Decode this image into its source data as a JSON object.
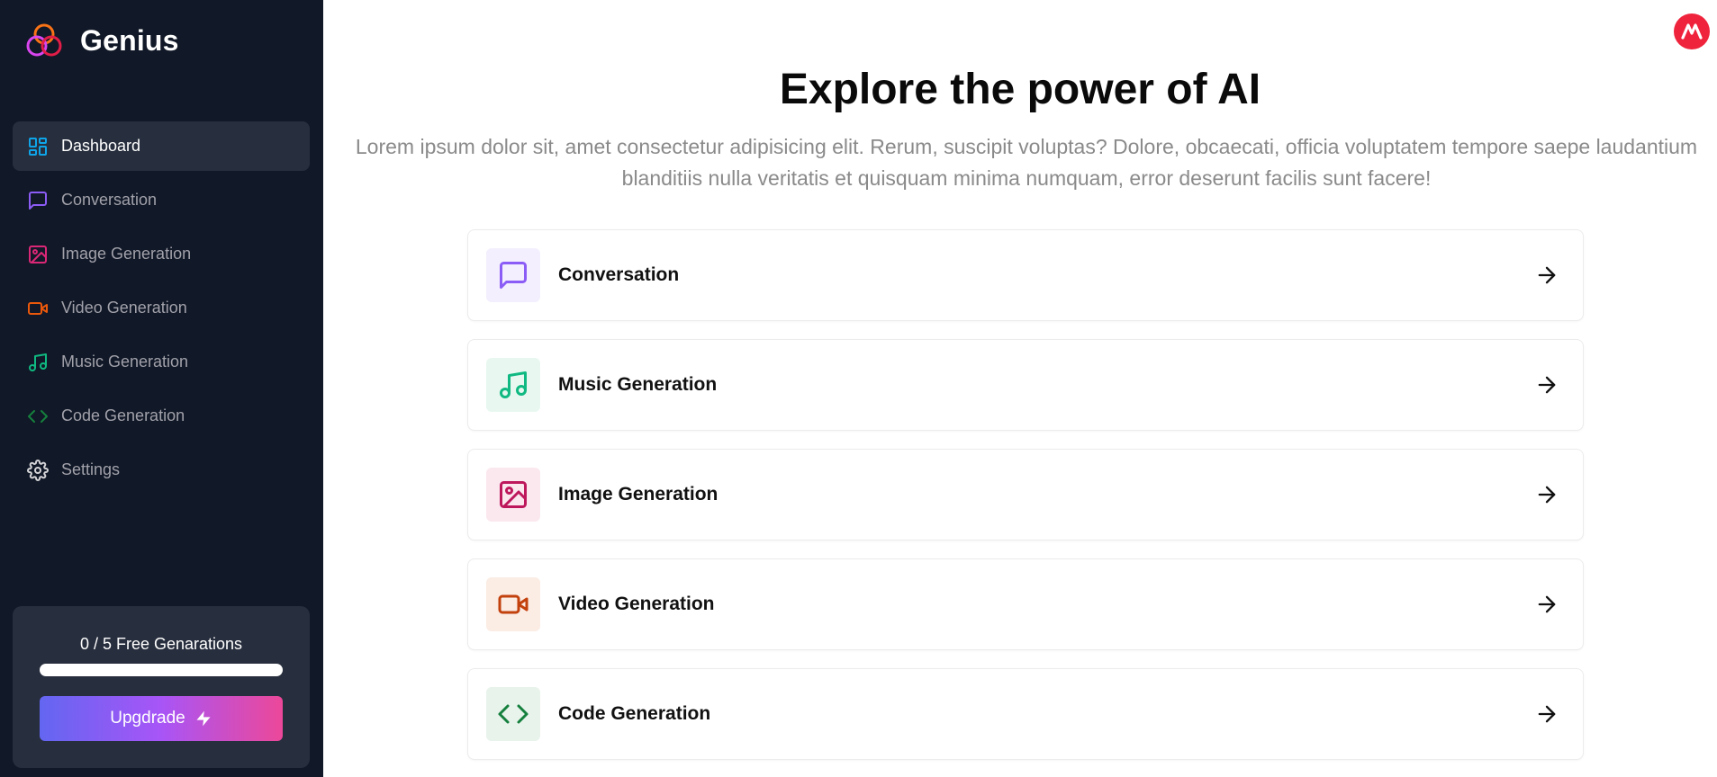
{
  "brand": {
    "name": "Genius"
  },
  "sidebar": {
    "items": [
      {
        "label": "Dashboard",
        "icon": "dashboard-icon",
        "color": "#0ea5e9",
        "active": true
      },
      {
        "label": "Conversation",
        "icon": "message-square-icon",
        "color": "#8b5cf6"
      },
      {
        "label": "Image Generation",
        "icon": "image-icon",
        "color": "#db2777"
      },
      {
        "label": "Video Generation",
        "icon": "video-icon",
        "color": "#ea580c"
      },
      {
        "label": "Music Generation",
        "icon": "music-icon",
        "color": "#10b981"
      },
      {
        "label": "Code Generation",
        "icon": "code-icon",
        "color": "#15803d"
      },
      {
        "label": "Settings",
        "icon": "settings-icon",
        "color": "#d4d4d8"
      }
    ],
    "credits": {
      "text": "0 / 5 Free Genarations",
      "used": 0,
      "limit": 5,
      "upgrade_label": "Upgdrade"
    }
  },
  "header": {
    "avatar_initial": "M",
    "avatar_color": "#ef233c"
  },
  "main": {
    "title": "Explore the power of AI",
    "description": "Lorem ipsum dolor sit, amet consectetur adipisicing elit. Rerum, suscipit voluptas? Dolore, obcaecati, officia voluptatem tempore saepe laudantium blanditiis nulla veritatis et quisquam minima numquam, error deserunt facilis sunt facere!",
    "tools": [
      {
        "label": "Conversation",
        "icon": "message-square-icon",
        "color": "#8b5cf6",
        "bg": "#f3effe"
      },
      {
        "label": "Music Generation",
        "icon": "music-icon",
        "color": "#10b981",
        "bg": "#e8f8f1"
      },
      {
        "label": "Image Generation",
        "icon": "image-icon",
        "color": "#be185d",
        "bg": "#fbe8ef"
      },
      {
        "label": "Video Generation",
        "icon": "video-icon",
        "color": "#c2410c",
        "bg": "#fbece4"
      },
      {
        "label": "Code Generation",
        "icon": "code-icon",
        "color": "#15803d",
        "bg": "#e8f3ec"
      }
    ]
  }
}
